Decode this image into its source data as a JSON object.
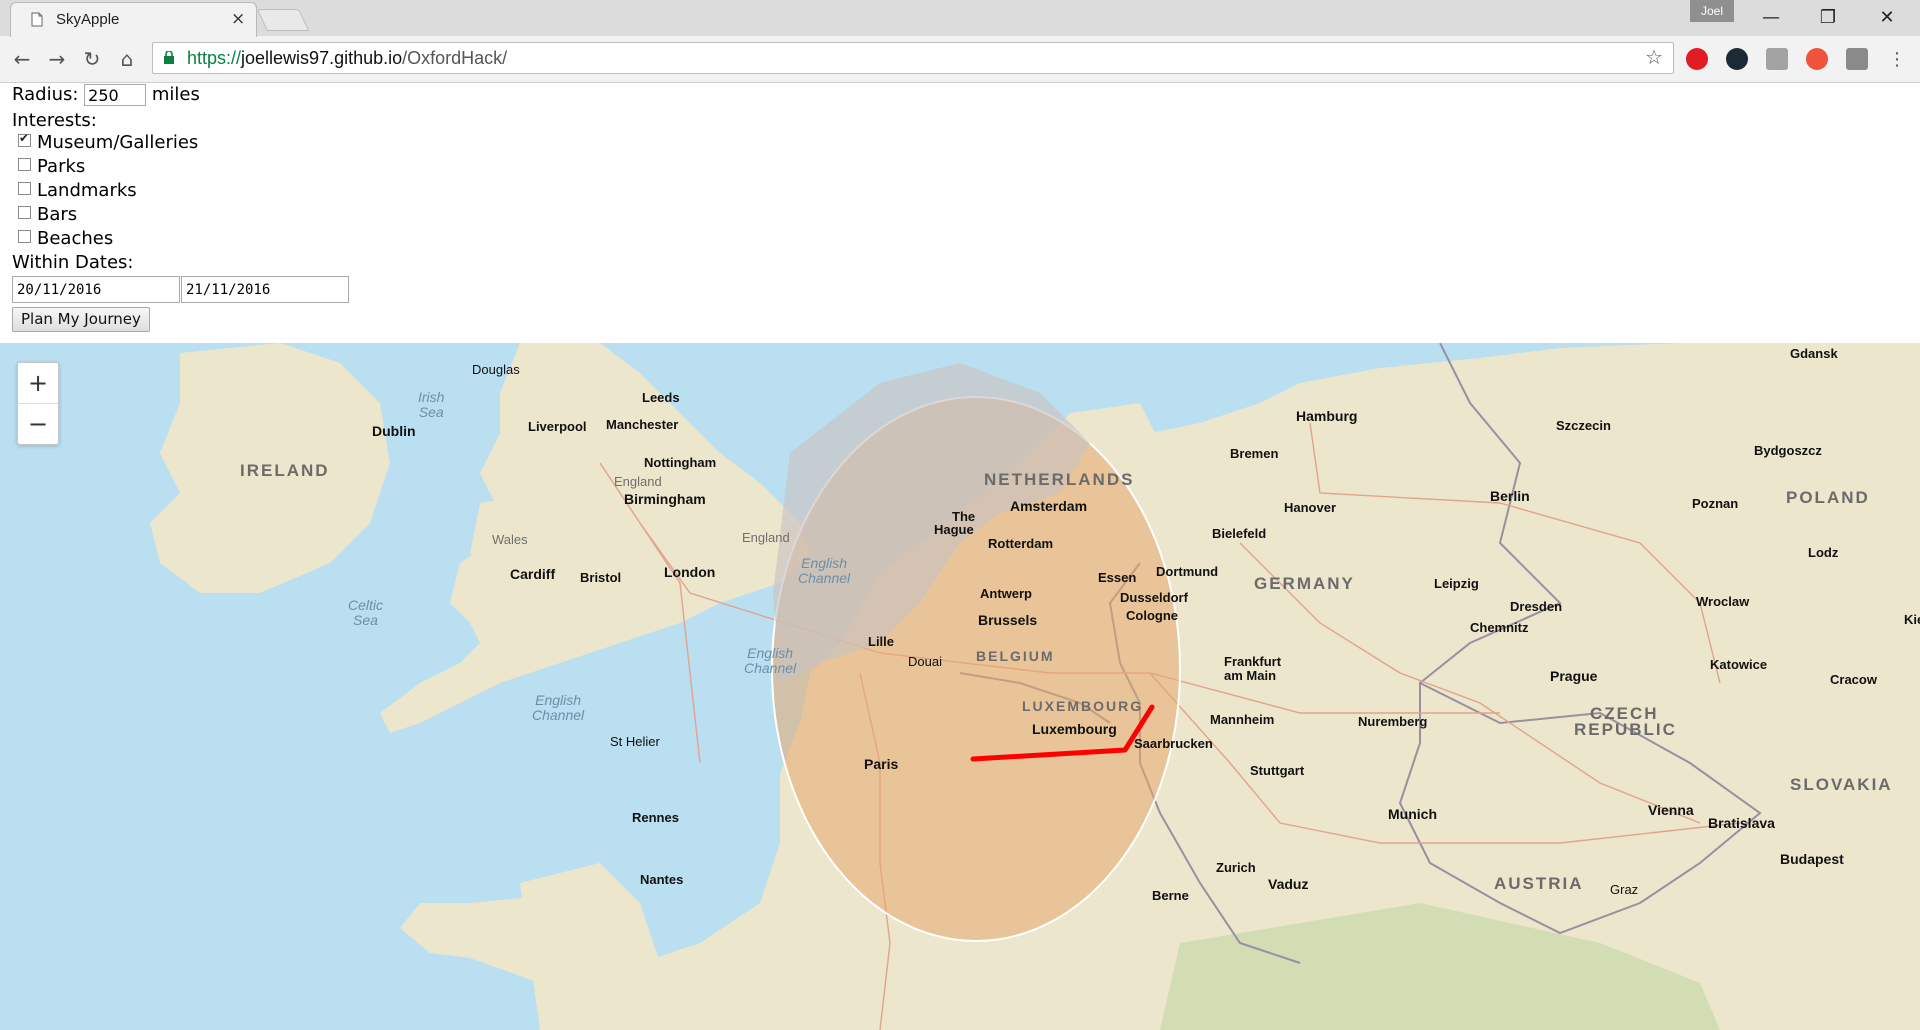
{
  "browser": {
    "tab_title": "SkyApple",
    "tab_close": "×",
    "profile_name": "Joel",
    "url_protocol": "https://",
    "url_host": "joellewis97.github.io",
    "url_path": "/OxfordHack/",
    "window_controls": {
      "minimize": "—",
      "restore": "❐",
      "close": "✕"
    },
    "nav": {
      "back": "←",
      "forward": "→",
      "reload": "↻",
      "home": "⌂",
      "bookmark": "☆",
      "menu": "⋮"
    },
    "extensions": [
      {
        "name": "opera-icon",
        "color": "#e31b23"
      },
      {
        "name": "ublock-icon",
        "color": "#1c2a38"
      },
      {
        "name": "extension-gray-icon",
        "color": "#a3a3a3"
      },
      {
        "name": "adblock-icon",
        "color": "#f0523a"
      },
      {
        "name": "extension-photo-icon",
        "color": "#8a8a8a"
      }
    ]
  },
  "form": {
    "radius_label": "Radius:",
    "radius_value": "250",
    "radius_unit": "miles",
    "interests_label": "Interests:",
    "interests": [
      {
        "label": "Museum/Galleries",
        "checked": true
      },
      {
        "label": "Parks",
        "checked": false
      },
      {
        "label": "Landmarks",
        "checked": false
      },
      {
        "label": "Bars",
        "checked": false
      },
      {
        "label": "Beaches",
        "checked": false
      }
    ],
    "dates_label": "Within Dates:",
    "start_date": "20/11/2016",
    "end_date": "21/11/2016",
    "plan_button": "Plan My Journey"
  },
  "map": {
    "zoom_in": "+",
    "zoom_out": "−",
    "colors": {
      "sea": "#b9dff1",
      "land": "#ece6cd",
      "radius_fill": "#e8a76e",
      "route": "#ff0000"
    },
    "countries": [
      "IRELAND",
      "NETHERLANDS",
      "BELGIUM",
      "LUXEMBOURG",
      "GERMANY",
      "POLAND",
      "CZECH",
      "REPUBLIC",
      "SLOVAKIA",
      "AUSTRIA"
    ],
    "seas": [
      [
        "Irish",
        "Sea"
      ],
      [
        "Celtic",
        "Sea"
      ],
      [
        "English",
        "Channel"
      ],
      [
        "English",
        "Channel"
      ],
      [
        "English",
        "Channel"
      ]
    ],
    "regions": [
      "England",
      "Wales",
      "England"
    ],
    "cities": [
      "Douglas",
      "Leeds",
      "Dublin",
      "Liverpool",
      "Manchester",
      "Nottingham",
      "Birmingham",
      "Cardiff",
      "Bristol",
      "London",
      "St Helier",
      "Rennes",
      "Nantes",
      "Paris",
      "Lille",
      "Douai",
      "Brussels",
      "Antwerp",
      "Rotterdam",
      "The",
      "Hague",
      "Amsterdam",
      "Luxembourg",
      "Essen",
      "Dortmund",
      "Dusseldorf",
      "Cologne",
      "Saarbrucken",
      "Mannheim",
      "Frankfurt",
      "am Main",
      "Stuttgart",
      "Zurich",
      "Vaduz",
      "Munich",
      "Nuremberg",
      "Berne",
      "Hamburg",
      "Bremen",
      "Hanover",
      "Bielefeld",
      "Berlin",
      "Leipzig",
      "Dresden",
      "Chemnitz",
      "Prague",
      "Szczecin",
      "Bydgoszcz",
      "Poznan",
      "Lodz",
      "Wroclaw",
      "Katowice",
      "Cracow",
      "Gdansk",
      "Vienna",
      "Bratislava",
      "Budapest",
      "Graz",
      "Kie"
    ]
  }
}
